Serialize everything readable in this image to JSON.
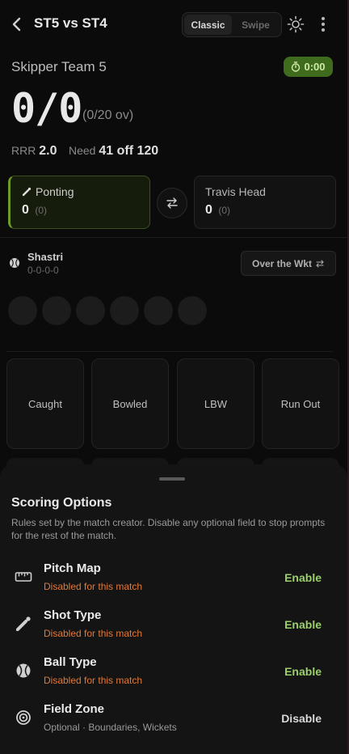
{
  "header": {
    "title": "ST5 vs ST4",
    "modes": [
      "Classic",
      "Swipe"
    ],
    "active_mode": "Classic"
  },
  "innings": {
    "team": "Skipper Team 5",
    "timer": "0:00",
    "score": "0/0",
    "overs": "(0/20 ov)",
    "rrr_label": "RRR",
    "rrr_value": "2.0",
    "need_label": "Need",
    "need_value": "41 off 120"
  },
  "batters": {
    "striker": {
      "name": "Ponting",
      "runs": "0",
      "balls": "(0)"
    },
    "non_striker": {
      "name": "Travis Head",
      "runs": "0",
      "balls": "(0)"
    }
  },
  "bowler": {
    "name": "Shastri",
    "figures": "0-0-0-0",
    "over_wkt_label": "Over the Wkt"
  },
  "dismissals": [
    "Caught",
    "Bowled",
    "LBW",
    "Run Out"
  ],
  "sheet": {
    "title": "Scoring Options",
    "description": "Rules set by the match creator. Disable any optional field to stop prompts for the rest of the match.",
    "options": [
      {
        "icon": "ruler-icon",
        "title": "Pitch Map",
        "subtitle": "Disabled for this match",
        "action": "Enable"
      },
      {
        "icon": "bat-ball-icon",
        "title": "Shot Type",
        "subtitle": "Disabled for this match",
        "action": "Enable"
      },
      {
        "icon": "ball-icon",
        "title": "Ball Type",
        "subtitle": "Disabled for this match",
        "action": "Enable"
      },
      {
        "icon": "target-icon",
        "title": "Field Zone",
        "subtitle": "Optional · Boundaries, Wickets",
        "action": "Disable"
      }
    ]
  },
  "colors": {
    "accent_green": "#9bd06a",
    "warning_orange": "#e07a3a",
    "timer_bg": "#3f6b1c"
  }
}
